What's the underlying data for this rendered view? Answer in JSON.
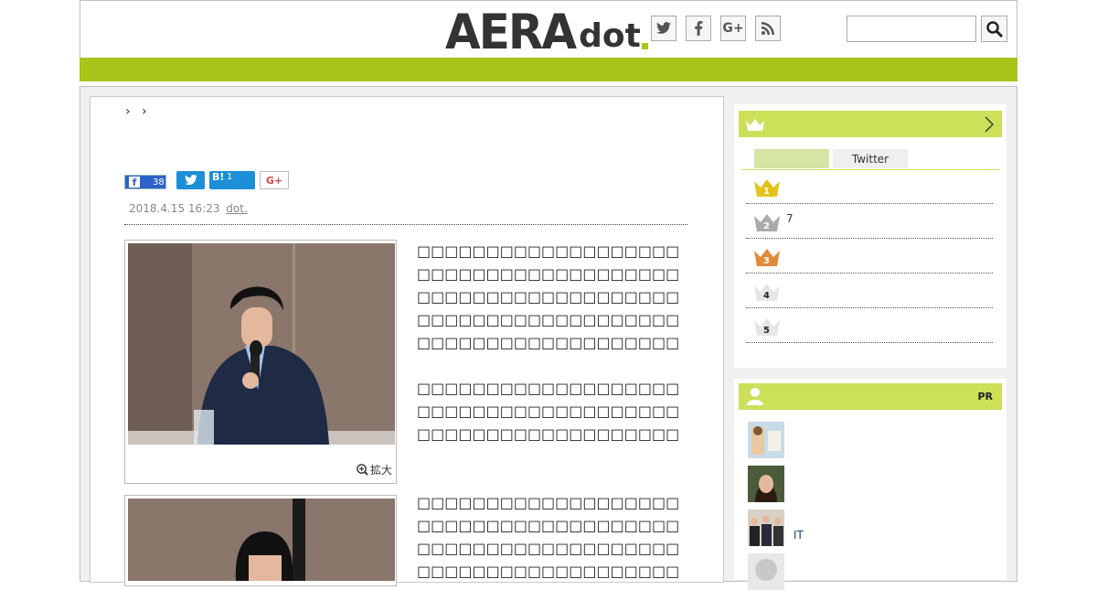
{
  "header": {
    "logo_main": "AERA",
    "logo_sub": "dot",
    "social": [
      "twitter-icon",
      "facebook-icon",
      "google-plus-icon",
      "rss-icon"
    ],
    "search": {
      "value": "",
      "placeholder": ""
    }
  },
  "breadcrumb": [
    "",
    ""
  ],
  "share": {
    "facebook_count": "38",
    "hatena_label": "B!",
    "hatena_count": "1",
    "googleplus_label": "G+"
  },
  "article": {
    "date": "2018.4.15 16:23",
    "source": "dot.",
    "zoom_label": "拡大",
    "paragraphs": [
      "□□□□□□□□□□□□□□□□□□□□□□□□□□□□□□□□□□□□□□□□□□□□□□□□□□□□□□□□□□□□□□□□□□□□□□□□□□□□□□□□□□□□□□□□□□□□□□□□□",
      "□□□□□□□□□□□□□□□□□□□□□□□□□□□□□□□□□□□□□□□□□□□□□□□□□□□□□□□□□",
      "□□□□□□□□□□□□□□□□□□□□□□□□□□□□□□□□□□□□□□□□□□□□□□□□□□□□□□□□□□□□□□□□□□□□□□□□□□□□"
    ]
  },
  "sidebar": {
    "ranking": {
      "tabs": [
        "",
        "Twitter"
      ],
      "items": [
        {
          "rank": "1",
          "text": ""
        },
        {
          "rank": "2",
          "text": "7"
        },
        {
          "rank": "3",
          "text": ""
        },
        {
          "rank": "4",
          "text": ""
        },
        {
          "rank": "5",
          "text": ""
        }
      ],
      "colors": {
        "gold": "#e3c31a",
        "silver": "#aaaaaa",
        "bronze": "#e08a3a",
        "plain": "#dddddd"
      }
    },
    "pr": {
      "label": "PR",
      "items": [
        {
          "text": ""
        },
        {
          "text": ""
        },
        {
          "text": "IT"
        },
        {
          "text": ""
        }
      ]
    }
  },
  "colors": {
    "accent": "#aac41a",
    "sidebar_head": "#cce05a"
  }
}
